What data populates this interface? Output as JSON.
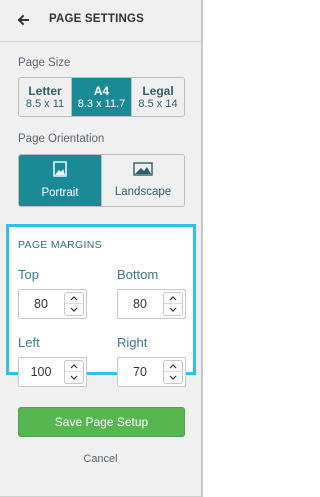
{
  "header": {
    "title": "PAGE SETTINGS",
    "back_icon": "arrow-left-icon"
  },
  "page_size": {
    "label": "Page Size",
    "options": [
      {
        "name": "Letter",
        "dims": "8.5 x 11",
        "selected": false
      },
      {
        "name": "A4",
        "dims": "8.3 x 11.7",
        "selected": true
      },
      {
        "name": "Legal",
        "dims": "8.5 x 14",
        "selected": false
      }
    ]
  },
  "orientation": {
    "label": "Page Orientation",
    "options": [
      {
        "name": "Portrait",
        "icon": "portrait-image-icon",
        "selected": true
      },
      {
        "name": "Landscape",
        "icon": "landscape-image-icon",
        "selected": false
      }
    ]
  },
  "margins": {
    "title": "PAGE MARGINS",
    "top": {
      "label": "Top",
      "value": "80"
    },
    "bottom": {
      "label": "Bottom",
      "value": "80"
    },
    "left": {
      "label": "Left",
      "value": "100"
    },
    "right": {
      "label": "Right",
      "value": "70"
    }
  },
  "actions": {
    "save_label": "Save Page Setup",
    "cancel_label": "Cancel"
  },
  "colors": {
    "accent": "#1a8a96",
    "highlight_border": "#2fc0e6",
    "save_button": "#56b64f"
  }
}
